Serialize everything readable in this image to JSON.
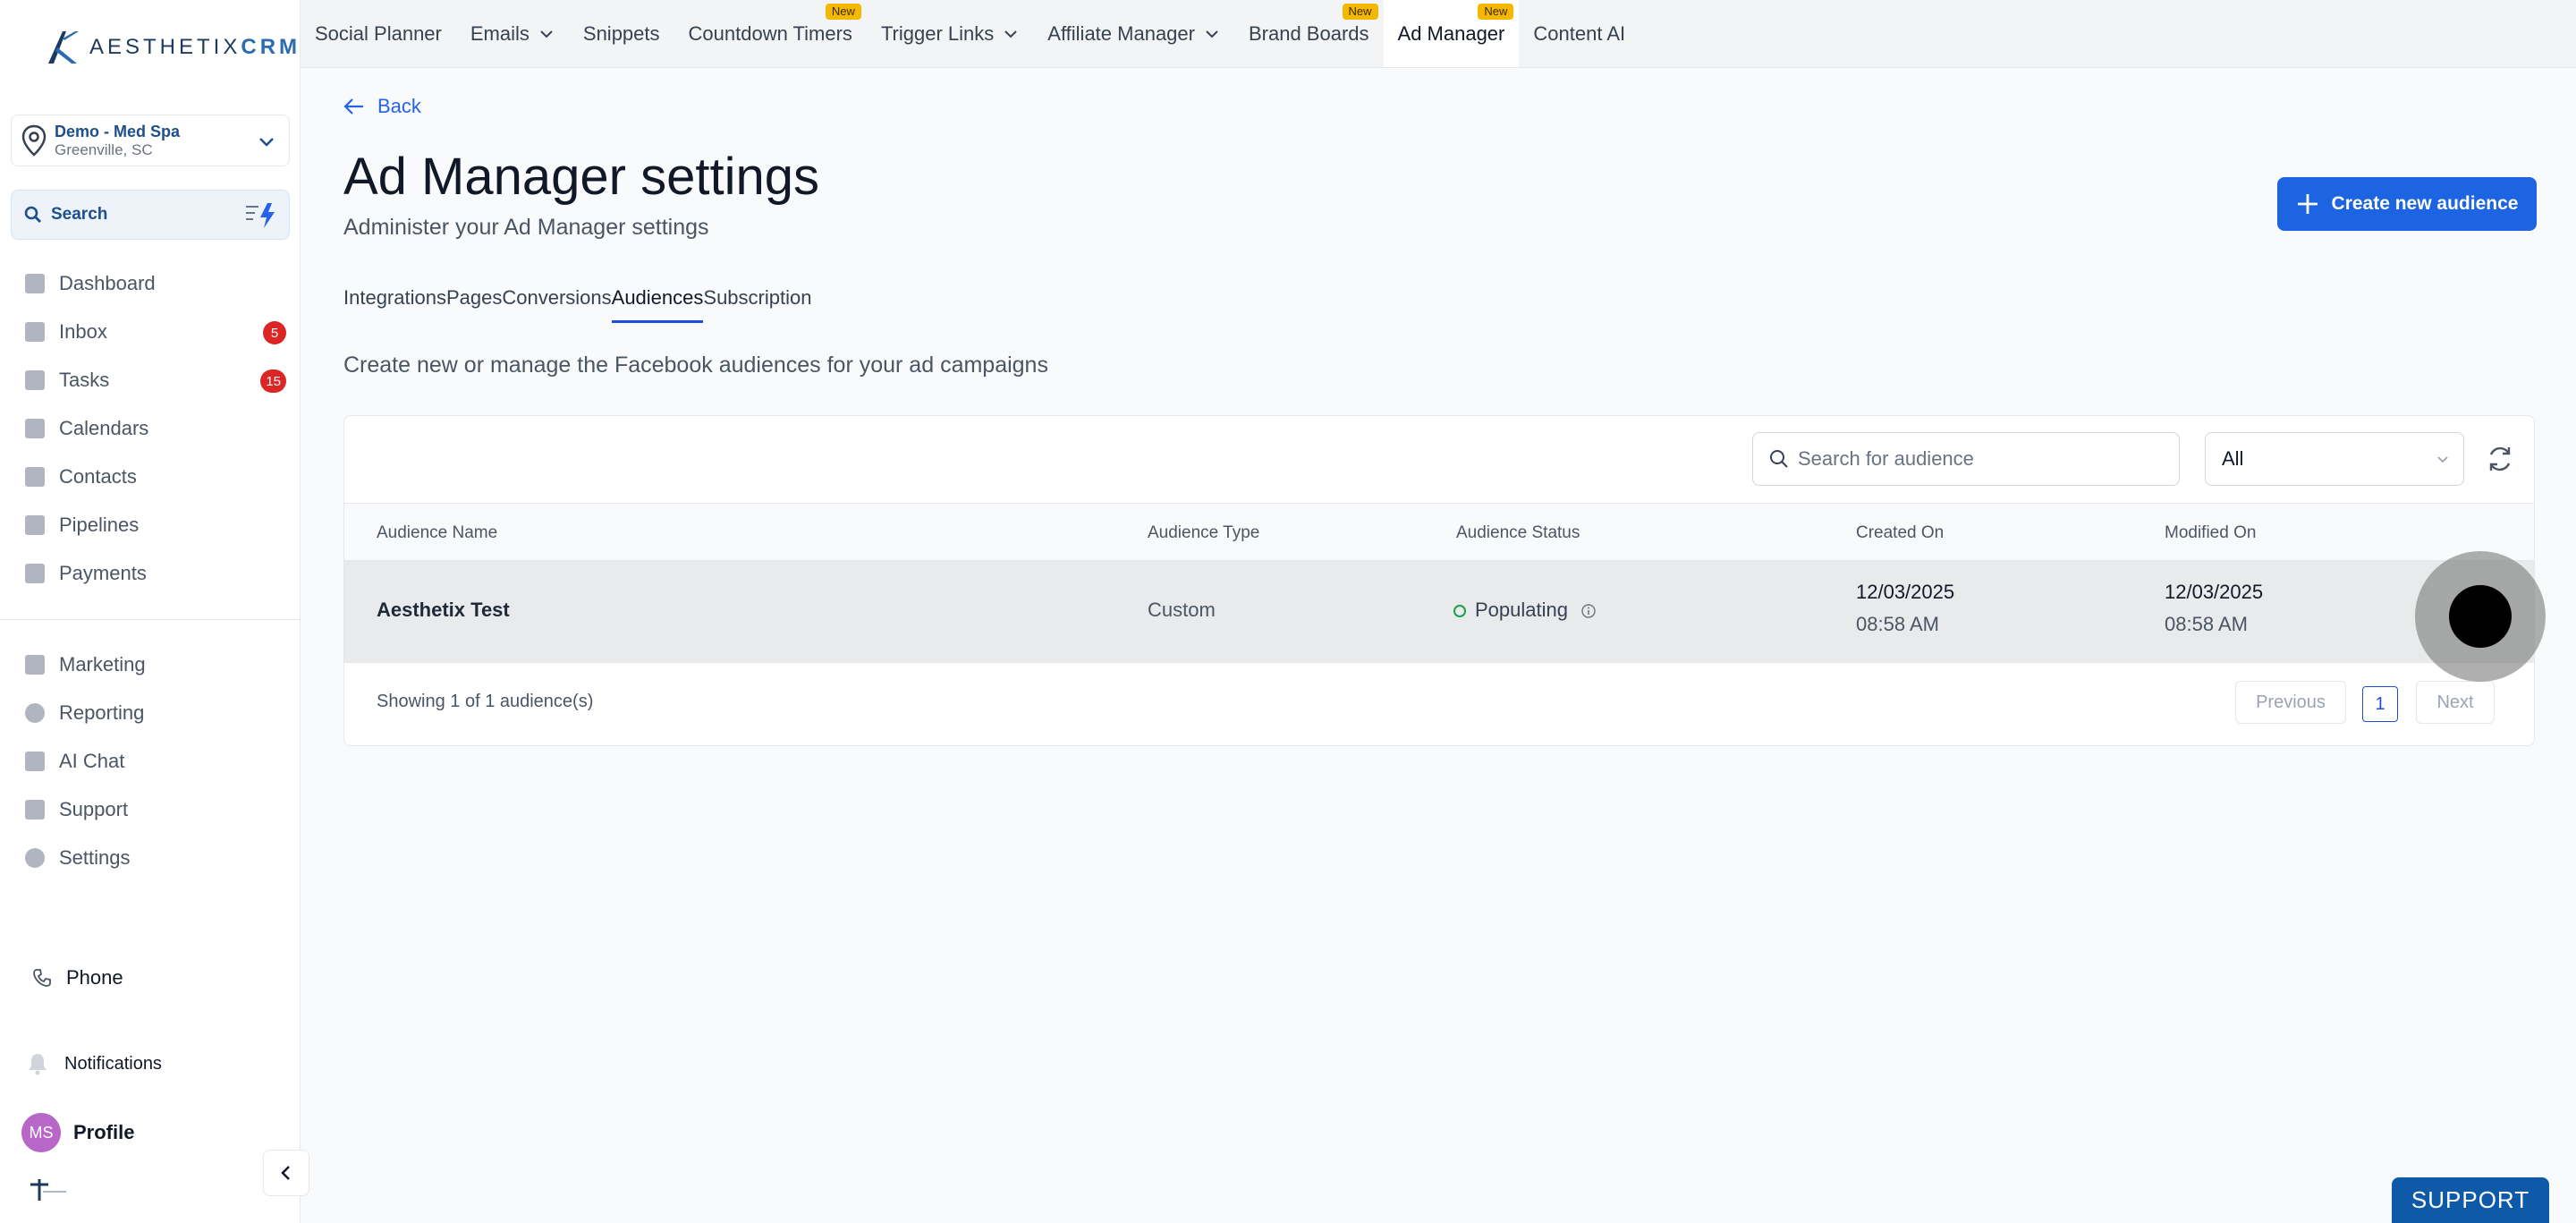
{
  "brand": {
    "name_light": "AESTHETIX",
    "name_bold": "CRM"
  },
  "location": {
    "name": "Demo - Med Spa",
    "city": "Greenville, SC"
  },
  "search": {
    "label": "Search"
  },
  "sidebar": {
    "items": [
      {
        "label": "Dashboard",
        "icon": "dashboard-icon"
      },
      {
        "label": "Inbox",
        "icon": "inbox-icon",
        "badge": "5"
      },
      {
        "label": "Tasks",
        "icon": "tasks-icon",
        "badge": "15"
      },
      {
        "label": "Calendars",
        "icon": "calendar-icon"
      },
      {
        "label": "Contacts",
        "icon": "contacts-icon"
      },
      {
        "label": "Pipelines",
        "icon": "pipelines-icon"
      },
      {
        "label": "Payments",
        "icon": "payments-icon"
      }
    ],
    "items2": [
      {
        "label": "Marketing",
        "icon": "marketing-icon"
      },
      {
        "label": "Reporting",
        "icon": "reporting-icon"
      },
      {
        "label": "AI Chat",
        "icon": "ai-chat-icon"
      },
      {
        "label": "Support",
        "icon": "support-icon"
      },
      {
        "label": "Settings",
        "icon": "settings-icon"
      }
    ],
    "phone": "Phone",
    "notifications": "Notifications",
    "profile": {
      "initials": "MS",
      "label": "Profile"
    }
  },
  "topnav": {
    "items": [
      {
        "label": "Social Planner"
      },
      {
        "label": "Emails",
        "dropdown": true
      },
      {
        "label": "Snippets"
      },
      {
        "label": "Countdown Timers",
        "tag": "New"
      },
      {
        "label": "Trigger Links",
        "dropdown": true
      },
      {
        "label": "Affiliate Manager",
        "dropdown": true
      },
      {
        "label": "Brand Boards",
        "tag": "New"
      },
      {
        "label": "Ad Manager",
        "tag": "New",
        "active": true
      },
      {
        "label": "Content AI"
      }
    ]
  },
  "main": {
    "back": "Back",
    "title": "Ad Manager settings",
    "subtitle": "Administer your Ad Manager settings",
    "create_button": "Create new audience",
    "tabs": [
      "Integrations",
      "Pages",
      "Conversions",
      "Audiences",
      "Subscription"
    ],
    "active_tab": "Audiences",
    "description": "Create new or manage the Facebook audiences for your ad campaigns"
  },
  "audiences": {
    "search_placeholder": "Search for audience",
    "filter_value": "All",
    "columns": [
      "Audience Name",
      "Audience Type",
      "Audience Status",
      "Created On",
      "Modified On"
    ],
    "rows": [
      {
        "name": "Aesthetix Test",
        "type": "Custom",
        "status": "Populating",
        "created_date": "12/03/2025",
        "created_time": "08:58 AM",
        "modified_date": "12/03/2025",
        "modified_time": "08:58 AM"
      }
    ],
    "showing": "Showing 1 of 1 audience(s)",
    "previous": "Previous",
    "page": "1",
    "next": "Next"
  },
  "support_button": "SUPPORT",
  "colors": {
    "accent": "#1d64e3",
    "badge": "#dc2626",
    "new_tag": "#f5b800",
    "status_ok": "#16a34a"
  }
}
